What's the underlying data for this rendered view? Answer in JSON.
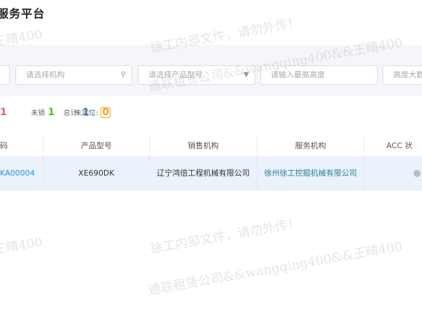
{
  "header": {
    "title": "服务平台"
  },
  "filters": {
    "org_placeholder": "请选择机构",
    "model_placeholder": "请选择产品型号",
    "max_placeholder": "请输入最高高度",
    "high_placeholder": "高度大数"
  },
  "stats": {
    "unlocked_label": "未锁",
    "unlocked_value": "1",
    "total_label": "总计:",
    "total_value": "1",
    "unlocated_label": "未定位:",
    "unlocated_value": "0"
  },
  "table": {
    "columns": [
      "码",
      "产品型号",
      "销售机构",
      "服务机构",
      "ACC 状"
    ],
    "rows": [
      {
        "code": "KA00004",
        "model": "XE690DK",
        "sales_org": "辽宁鸿倍工程机械有限公司",
        "service_org": "徐州徐工挖掘机械有限公司"
      }
    ]
  },
  "watermark": {
    "line1": "徐工内部文件，请勿外传！",
    "line2": "通联租赁公司&&wangqing400&&王晴400",
    "short": "王晴400"
  }
}
